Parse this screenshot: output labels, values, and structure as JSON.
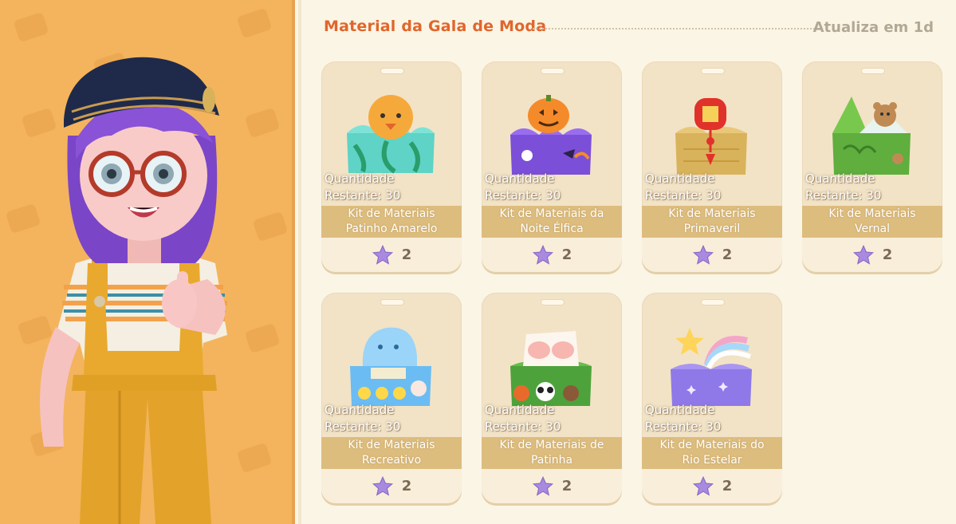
{
  "section": {
    "title": "Material da Gala de Moda",
    "refresh": "Atualiza em 1d"
  },
  "items": [
    {
      "qty_label": "Quantidade",
      "remaining": "Restante: 30",
      "name": "Kit de Materiais Patinho Amarelo",
      "price": "2",
      "icon": "yellow-duck-kit-icon",
      "colors": {
        "box": "#5ed3c6",
        "accent": "#f6a93b"
      }
    },
    {
      "qty_label": "Quantidade",
      "remaining": "Restante: 30",
      "name": "Kit de Materiais da Noite Élfica",
      "price": "2",
      "icon": "halloween-kit-icon",
      "colors": {
        "box": "#7c4fd8",
        "accent": "#f58a2a"
      }
    },
    {
      "qty_label": "Quantidade",
      "remaining": "Restante: 30",
      "name": "Kit de Materiais Primaveril",
      "price": "2",
      "icon": "spring-lantern-kit-icon",
      "colors": {
        "box": "#d9b25c",
        "accent": "#e0322a"
      }
    },
    {
      "qty_label": "Quantidade",
      "remaining": "Restante: 30",
      "name": "Kit de Materiais Vernal",
      "price": "2",
      "icon": "vernal-bear-kit-icon",
      "colors": {
        "box": "#5fae3e",
        "accent": "#c08a54"
      }
    },
    {
      "qty_label": "Quantidade",
      "remaining": "Restante: 30",
      "name": "Kit de Materiais Recreativo",
      "price": "2",
      "icon": "recreational-kit-icon",
      "colors": {
        "box": "#6bbcf2",
        "accent": "#ffd84a"
      }
    },
    {
      "qty_label": "Quantidade",
      "remaining": "Restante: 30",
      "name": "Kit de Materiais de Patinha",
      "price": "2",
      "icon": "paw-kit-icon",
      "colors": {
        "box": "#4ea23b",
        "accent": "#f7b6b0"
      }
    },
    {
      "qty_label": "Quantidade",
      "remaining": "Restante: 30",
      "name": "Kit de Materiais do Rio Estelar",
      "price": "2",
      "icon": "star-river-kit-icon",
      "colors": {
        "box": "#8f79e8",
        "accent": "#ffd45a"
      }
    }
  ],
  "currency": {
    "icon": "purple-star-icon",
    "color": "#a98ae0"
  },
  "character": {
    "icon": "avatar-character-icon",
    "bg": "#f3b45d"
  }
}
